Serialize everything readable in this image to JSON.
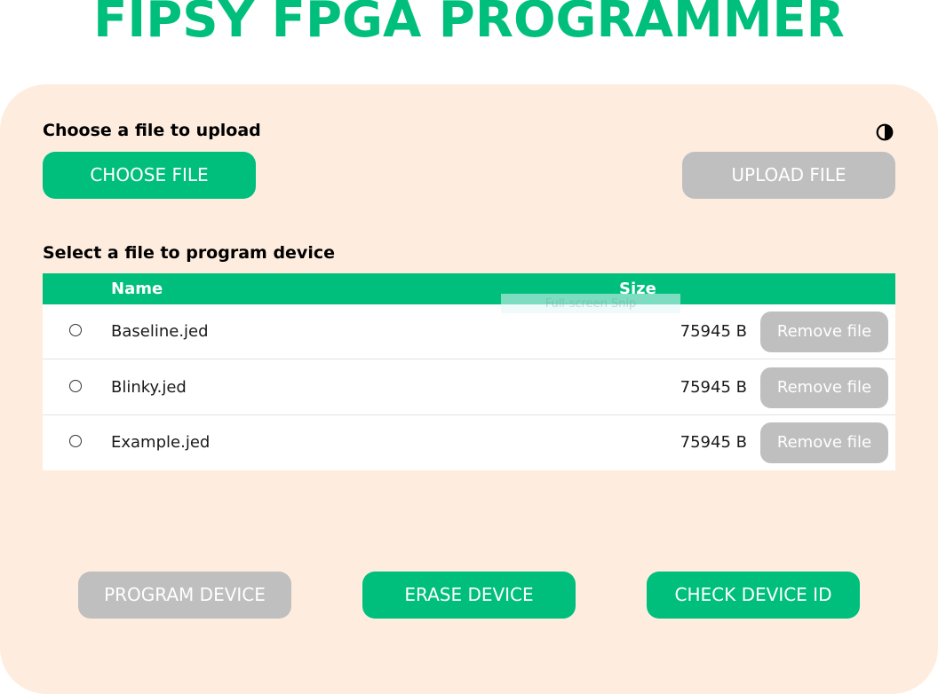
{
  "app": {
    "title": "FIPSY FPGA PROGRAMMER"
  },
  "upload": {
    "heading": "Choose a file to upload",
    "choose_label": "CHOOSE FILE",
    "upload_label": "UPLOAD FILE",
    "upload_enabled": false,
    "theme_icon": "contrast-icon"
  },
  "files": {
    "heading": "Select a file to program device",
    "columns": {
      "name": "Name",
      "size": "Size"
    },
    "rows": [
      {
        "name": "Baseline.jed",
        "size": "75945 B",
        "remove_label": "Remove file",
        "selected": false
      },
      {
        "name": "Blinky.jed",
        "size": "75945 B",
        "remove_label": "Remove file",
        "selected": false
      },
      {
        "name": "Example.jed",
        "size": "75945 B",
        "remove_label": "Remove file",
        "selected": false
      }
    ]
  },
  "overlay": {
    "snip_text": "Full-screen Snip"
  },
  "actions": {
    "program_label": "PROGRAM DEVICE",
    "program_enabled": false,
    "erase_label": "ERASE DEVICE",
    "check_label": "CHECK DEVICE ID"
  },
  "colors": {
    "accent": "#00bf7d",
    "panel_bg": "#feeddf",
    "disabled": "#bfbfbf"
  }
}
